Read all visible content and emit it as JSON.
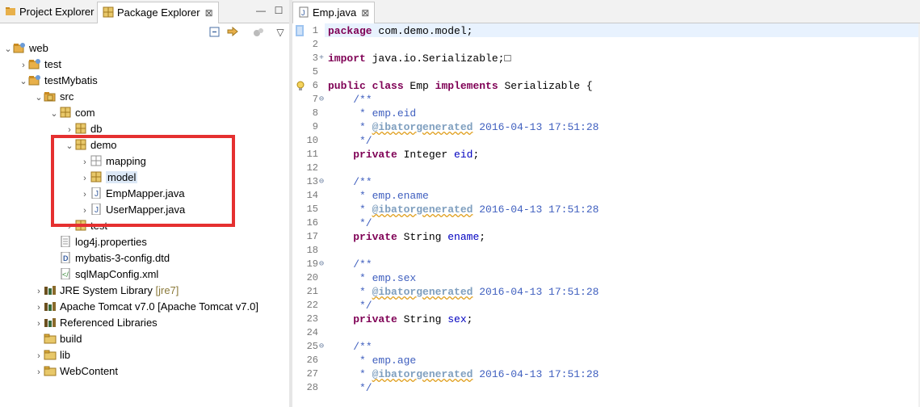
{
  "left": {
    "tabs": [
      {
        "label": "Project Explorer",
        "active": false
      },
      {
        "label": "Package Explorer",
        "active": true,
        "close": "⊠"
      }
    ],
    "tree": [
      {
        "label": "web",
        "icon": "project-icon",
        "arrow": "⌄",
        "indent": 0,
        "name": "tree-item-web"
      },
      {
        "label": "test",
        "icon": "project-icon",
        "arrow": "›",
        "indent": 1,
        "name": "tree-item-test"
      },
      {
        "label": "testMybatis",
        "icon": "project-icon",
        "arrow": "⌄",
        "indent": 1,
        "name": "tree-item-testmybatis"
      },
      {
        "label": "src",
        "icon": "source-folder-icon",
        "arrow": "⌄",
        "indent": 2,
        "name": "tree-item-src"
      },
      {
        "label": "com",
        "icon": "package-icon",
        "arrow": "⌄",
        "indent": 3,
        "name": "tree-item-com"
      },
      {
        "label": "db",
        "icon": "package-icon",
        "arrow": "›",
        "indent": 4,
        "name": "tree-item-db"
      },
      {
        "label": "demo",
        "icon": "package-icon",
        "arrow": "⌄",
        "indent": 4,
        "name": "tree-item-demo"
      },
      {
        "label": "mapping",
        "icon": "empty-package-icon",
        "arrow": "›",
        "indent": 5,
        "name": "tree-item-mapping"
      },
      {
        "label": "model",
        "icon": "package-icon",
        "arrow": "›",
        "indent": 5,
        "name": "tree-item-model",
        "selected": true
      },
      {
        "label": "EmpMapper.java",
        "icon": "java-file-icon",
        "arrow": "›",
        "indent": 5,
        "name": "tree-item-empmapper"
      },
      {
        "label": "UserMapper.java",
        "icon": "java-file-icon",
        "arrow": "›",
        "indent": 5,
        "name": "tree-item-usermapper"
      },
      {
        "label": "test",
        "icon": "package-icon",
        "arrow": "›",
        "indent": 4,
        "name": "tree-item-test-pkg"
      },
      {
        "label": "log4j.properties",
        "icon": "text-file-icon",
        "arrow": "",
        "indent": 3,
        "name": "tree-item-log4j"
      },
      {
        "label": "mybatis-3-config.dtd",
        "icon": "dtd-file-icon",
        "arrow": "",
        "indent": 3,
        "name": "tree-item-dtd"
      },
      {
        "label": "sqlMapConfig.xml",
        "icon": "xml-file-icon",
        "arrow": "",
        "indent": 3,
        "name": "tree-item-sqlmapconfig"
      },
      {
        "label": "JRE System Library",
        "decor": "[jre7]",
        "icon": "library-icon",
        "arrow": "›",
        "indent": 2,
        "name": "tree-item-jre"
      },
      {
        "label": "Apache Tomcat v7.0 [Apache Tomcat v7.0]",
        "icon": "library-icon",
        "arrow": "›",
        "indent": 2,
        "name": "tree-item-tomcat"
      },
      {
        "label": "Referenced Libraries",
        "icon": "library-icon",
        "arrow": "›",
        "indent": 2,
        "name": "tree-item-reflibs"
      },
      {
        "label": "build",
        "icon": "folder-icon",
        "arrow": "",
        "indent": 2,
        "name": "tree-item-build"
      },
      {
        "label": "lib",
        "icon": "folder-icon",
        "arrow": "›",
        "indent": 2,
        "name": "tree-item-lib"
      },
      {
        "label": "WebContent",
        "icon": "folder-icon",
        "arrow": "›",
        "indent": 2,
        "name": "tree-item-webcontent"
      }
    ]
  },
  "editor": {
    "tab_label": "Emp.java",
    "tab_close": "⊠",
    "lines": [
      {
        "n": "1",
        "html": "<span class='kw'>package</span> com.demo.model;"
      },
      {
        "n": "2",
        "html": ""
      },
      {
        "n": "3",
        "fold": "+",
        "html": "<span class='kw'>import</span> java.io.Serializable;&#9633;"
      },
      {
        "n": "5",
        "html": ""
      },
      {
        "n": "6",
        "html": "<span class='kw'>public class</span> Emp <span class='kw'>implements</span> Serializable {"
      },
      {
        "n": "7",
        "fold": "⊖",
        "html": "    <span class='cm'>/**</span>"
      },
      {
        "n": "8",
        "html": "<span class='cm'>     * emp.eid</span>"
      },
      {
        "n": "9",
        "html": "<span class='cm'>     * <span class='tag tagline'>@ibatorgenerated</span> 2016-04-13 17:51:28</span>"
      },
      {
        "n": "10",
        "html": "<span class='cm'>     */</span>"
      },
      {
        "n": "11",
        "html": "    <span class='kw'>private</span> Integer <span class='fld'>eid</span>;"
      },
      {
        "n": "12",
        "html": ""
      },
      {
        "n": "13",
        "fold": "⊖",
        "html": "    <span class='cm'>/**</span>"
      },
      {
        "n": "14",
        "html": "<span class='cm'>     * emp.ename</span>"
      },
      {
        "n": "15",
        "html": "<span class='cm'>     * <span class='tag tagline'>@ibatorgenerated</span> 2016-04-13 17:51:28</span>"
      },
      {
        "n": "16",
        "html": "<span class='cm'>     */</span>"
      },
      {
        "n": "17",
        "html": "    <span class='kw'>private</span> String <span class='fld'>ename</span>;"
      },
      {
        "n": "18",
        "html": ""
      },
      {
        "n": "19",
        "fold": "⊖",
        "html": "    <span class='cm'>/**</span>"
      },
      {
        "n": "20",
        "html": "<span class='cm'>     * emp.sex</span>"
      },
      {
        "n": "21",
        "html": "<span class='cm'>     * <span class='tag tagline'>@ibatorgenerated</span> 2016-04-13 17:51:28</span>"
      },
      {
        "n": "22",
        "html": "<span class='cm'>     */</span>"
      },
      {
        "n": "23",
        "html": "    <span class='kw'>private</span> String <span class='fld'>sex</span>;"
      },
      {
        "n": "24",
        "html": ""
      },
      {
        "n": "25",
        "fold": "⊖",
        "html": "    <span class='cm'>/**</span>"
      },
      {
        "n": "26",
        "html": "<span class='cm'>     * emp.age</span>"
      },
      {
        "n": "27",
        "html": "<span class='cm'>     * <span class='tag tagline'>@ibatorgenerated</span> 2016-04-13 17:51:28</span>"
      },
      {
        "n": "28",
        "html": "<span class='cm'>     */</span>"
      }
    ]
  },
  "colors": {
    "highlight_box": "#e53030",
    "selection": "#dce8f6",
    "keyword": "#7f0055",
    "comment": "#3f5fbf"
  }
}
